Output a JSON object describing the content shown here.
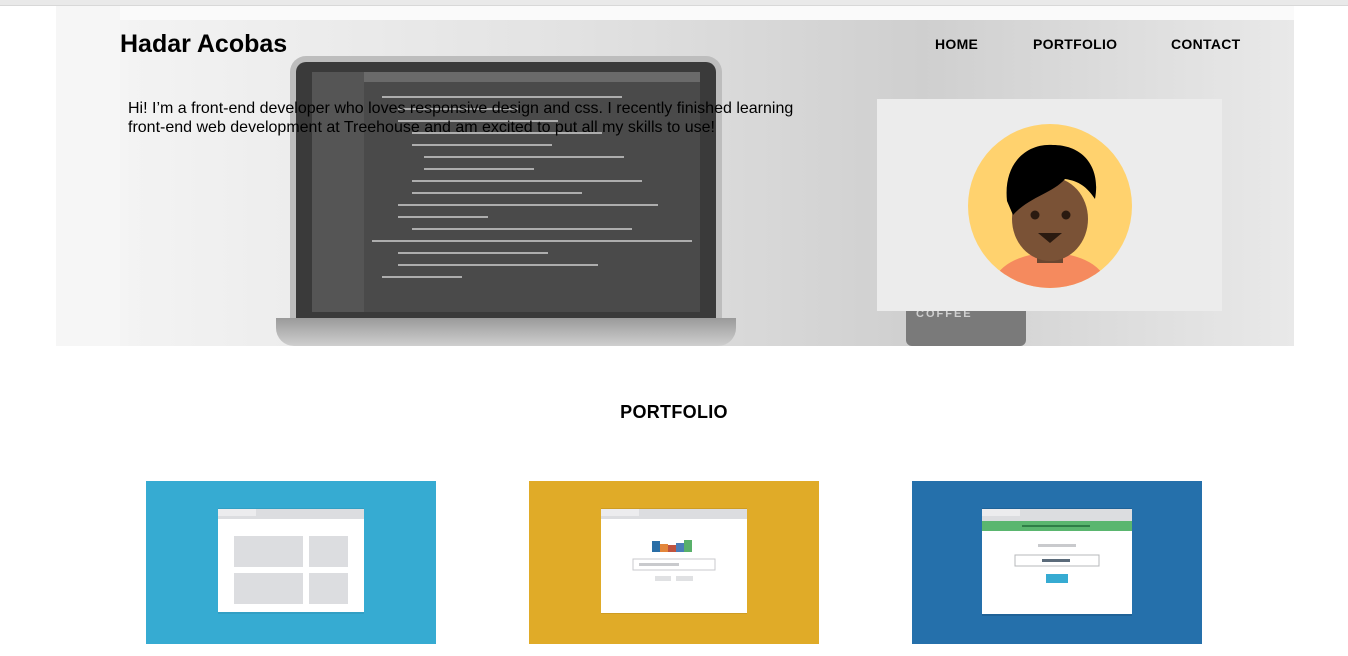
{
  "site": {
    "title": "Hadar Acobas"
  },
  "nav": {
    "home": "HOME",
    "portfolio": "PORTFOLIO",
    "contact": "CONTACT"
  },
  "hero": {
    "intro": "Hi! I’m a front-end developer who loves responsive design and css. I recently finished learning front-end web development at Treehouse and am excited to put all my skills to use!",
    "mug_text": "COFFEE"
  },
  "portfolio": {
    "heading": "PORTFOLIO"
  },
  "colors": {
    "tile_1": "#36abd2",
    "tile_2": "#e0ab28",
    "tile_3": "#2570ab",
    "avatar_bg": "#ffd26e",
    "avatar_skin": "#7a5236",
    "avatar_shirt": "#f58a5e"
  },
  "icons": {
    "avatar": "person-avatar-icon",
    "tile_1": "browser-grid-layout-icon",
    "tile_2": "browser-bar-chart-icon",
    "tile_3": "browser-login-form-icon"
  }
}
